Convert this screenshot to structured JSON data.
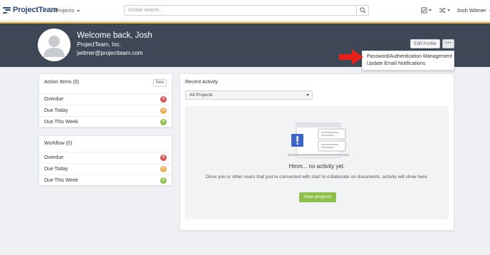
{
  "app": {
    "logo_text": "ProjectTeam"
  },
  "nav": {
    "projects_label": "Projects",
    "search_placeholder": "Global search...",
    "user_name": "Josh Witmer"
  },
  "header": {
    "welcome": "Welcome back, Josh",
    "company": "ProjectTeam, Inc.",
    "email": "jwitmer@projectteam.com",
    "edit_profile_label": "Edit Profile",
    "more_label": "···"
  },
  "dropdown": {
    "items": [
      {
        "label": "Password/Authentication Management"
      },
      {
        "label": "Update Email Notifications"
      }
    ]
  },
  "action_items": {
    "title": "Action Items (0)",
    "new_label": "New",
    "rows": [
      {
        "label": "Overdue",
        "count": "0"
      },
      {
        "label": "Due Today",
        "count": "0"
      },
      {
        "label": "Due This Week",
        "count": "0"
      }
    ]
  },
  "workflow": {
    "title": "Workflow (0)",
    "rows": [
      {
        "label": "Overdue",
        "count": "0"
      },
      {
        "label": "Due Today",
        "count": "0"
      },
      {
        "label": "Due This Week",
        "count": "0"
      }
    ]
  },
  "recent_activity": {
    "title": "Recent Activity",
    "filter_value": "All Projects",
    "empty_title": "Hmm... no activity yet.",
    "empty_message": "Once you or other users that you're connected with start to collaborate on documents, activity will show here.",
    "view_projects_label": "View projects"
  },
  "colors": {
    "header_bg": "#3d4756",
    "accent_stripe": "#f0b429",
    "badge_red": "#d9534f",
    "badge_yellow": "#f0ad4e",
    "badge_green": "#8cc04b",
    "primary_button": "#8cc04b",
    "annotation_arrow": "#e8201a"
  }
}
